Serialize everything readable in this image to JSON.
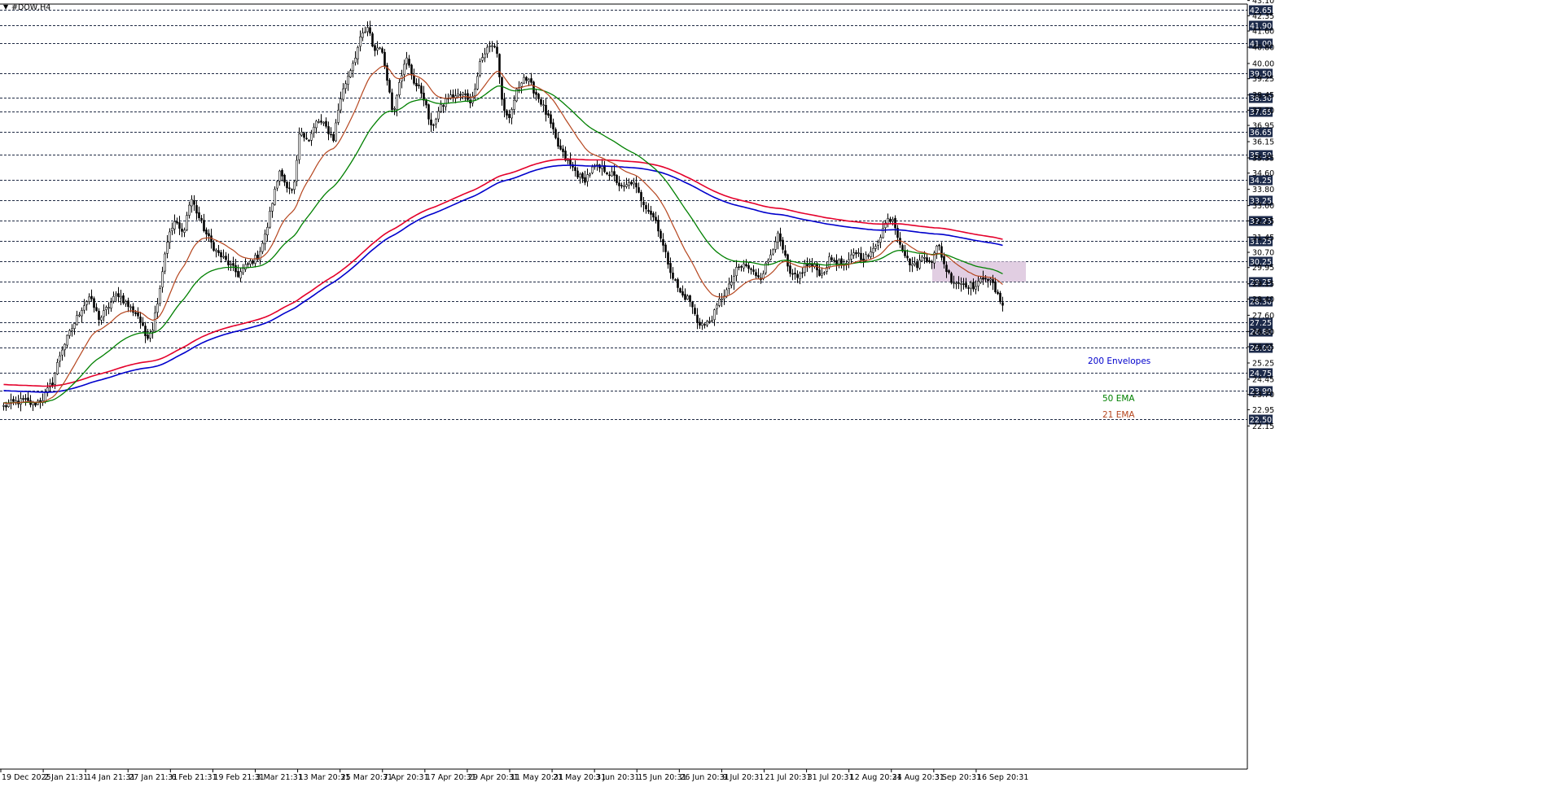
{
  "chart_data": {
    "type": "candlestick",
    "title": "#DOW,H4",
    "symbol": "#DOW",
    "timeframe": "H4",
    "ylim": [
      22.0,
      43.55
    ],
    "y_ticks": [
      43.1,
      42.35,
      41.6,
      40.8,
      40.0,
      39.25,
      38.45,
      37.7,
      36.95,
      36.15,
      35.35,
      34.6,
      33.8,
      33.0,
      32.25,
      31.45,
      30.7,
      29.95,
      29.15,
      28.4,
      27.6,
      26.8,
      26.05,
      25.25,
      24.45,
      23.7,
      22.95,
      22.15
    ],
    "y_tick_labels": [
      "43.10",
      "42.35",
      "41.60",
      "40.80",
      "40.00",
      "39.25",
      "38.45",
      "37.70",
      "36.95",
      "36.15",
      "35.35",
      "34.60",
      "33.80",
      "33.00",
      "32.25",
      "31.45",
      "30.70",
      "29.95",
      "29.15",
      "28.40",
      "27.60",
      "26.80",
      "26.05",
      "25.25",
      "24.45",
      "23.70",
      "22.95",
      "22.15"
    ],
    "levels": [
      43.5,
      42.65,
      41.9,
      41.0,
      39.5,
      38.3,
      37.65,
      36.65,
      35.5,
      34.25,
      33.25,
      32.25,
      31.25,
      30.25,
      29.25,
      28.3,
      27.25,
      26.8,
      26.0,
      24.75,
      23.9,
      22.5
    ],
    "level_labels": [
      "43.50",
      "42.65",
      "41.90",
      "41.00",
      "39.50",
      "38.30",
      "37.65",
      "36.65",
      "35.50",
      "34.25",
      "33.25",
      "32.25",
      "31.25",
      "30.25",
      "29.25",
      "28.30",
      "27.25",
      "26.80",
      "26.00",
      "24.75",
      "23.90",
      "22.50"
    ],
    "x_labels": [
      "19 Dec 2025",
      "2 Jan 21:31",
      "14 Jan 21:31",
      "27 Jan 21:31",
      "6 Feb 21:31",
      "19 Feb 21:31",
      "3 Mar 21:31",
      "13 Mar 20:31",
      "25 Mar 20:31",
      "7 Apr 20:31",
      "17 Apr 20:31",
      "29 Apr 20:31",
      "11 May 20:31",
      "21 May 20:31",
      "3 Jun 20:31",
      "15 Jun 20:31",
      "26 Jun 20:31",
      "9 Jul 20:31",
      "21 Jul 20:31",
      "31 Jul 20:31",
      "12 Aug 20:31",
      "24 Aug 20:31",
      "3 Sep 20:31",
      "16 Sep 20:31"
    ],
    "price_anchors": [
      [
        0,
        23.1
      ],
      [
        12,
        23.3
      ],
      [
        25,
        23.4
      ],
      [
        36,
        23.2
      ],
      [
        48,
        23.5
      ],
      [
        60,
        24.3
      ],
      [
        70,
        25.8
      ],
      [
        82,
        26.8
      ],
      [
        95,
        27.9
      ],
      [
        105,
        28.5
      ],
      [
        118,
        27.4
      ],
      [
        128,
        28.0
      ],
      [
        140,
        28.7
      ],
      [
        152,
        28.1
      ],
      [
        165,
        27.6
      ],
      [
        175,
        26.5
      ],
      [
        183,
        27.0
      ],
      [
        192,
        29.0
      ],
      [
        200,
        31.2
      ],
      [
        210,
        32.2
      ],
      [
        220,
        31.6
      ],
      [
        230,
        33.4
      ],
      [
        240,
        32.4
      ],
      [
        250,
        31.5
      ],
      [
        262,
        30.7
      ],
      [
        275,
        30.2
      ],
      [
        288,
        29.6
      ],
      [
        300,
        30.1
      ],
      [
        312,
        30.5
      ],
      [
        322,
        31.6
      ],
      [
        330,
        33.2
      ],
      [
        340,
        34.9
      ],
      [
        348,
        33.8
      ],
      [
        356,
        33.6
      ],
      [
        364,
        36.8
      ],
      [
        375,
        36.2
      ],
      [
        385,
        37.2
      ],
      [
        395,
        36.9
      ],
      [
        405,
        36.3
      ],
      [
        413,
        38.2
      ],
      [
        422,
        39.3
      ],
      [
        432,
        40.4
      ],
      [
        440,
        41.4
      ],
      [
        448,
        41.7
      ],
      [
        455,
        40.6
      ],
      [
        462,
        40.9
      ],
      [
        470,
        39.6
      ],
      [
        478,
        37.5
      ],
      [
        486,
        39.2
      ],
      [
        495,
        40.2
      ],
      [
        505,
        39.0
      ],
      [
        515,
        38.5
      ],
      [
        525,
        36.8
      ],
      [
        535,
        37.7
      ],
      [
        545,
        38.3
      ],
      [
        555,
        38.4
      ],
      [
        565,
        38.5
      ],
      [
        575,
        38.1
      ],
      [
        585,
        40.1
      ],
      [
        595,
        40.8
      ],
      [
        605,
        40.9
      ],
      [
        612,
        38.2
      ],
      [
        620,
        37.0
      ],
      [
        628,
        38.4
      ],
      [
        638,
        39.4
      ],
      [
        648,
        38.9
      ],
      [
        660,
        38.1
      ],
      [
        670,
        37.2
      ],
      [
        680,
        36.0
      ],
      [
        690,
        35.3
      ],
      [
        700,
        34.8
      ],
      [
        712,
        34.2
      ],
      [
        725,
        34.9
      ],
      [
        737,
        34.8
      ],
      [
        748,
        34.5
      ],
      [
        760,
        33.8
      ],
      [
        772,
        34.2
      ],
      [
        782,
        33.4
      ],
      [
        792,
        32.8
      ],
      [
        802,
        32.2
      ],
      [
        812,
        30.7
      ],
      [
        822,
        29.5
      ],
      [
        832,
        28.6
      ],
      [
        842,
        28.4
      ],
      [
        852,
        27.3
      ],
      [
        862,
        27.1
      ],
      [
        872,
        27.6
      ],
      [
        880,
        28.4
      ],
      [
        890,
        28.9
      ],
      [
        900,
        29.8
      ],
      [
        910,
        30.1
      ],
      [
        920,
        29.7
      ],
      [
        930,
        29.5
      ],
      [
        940,
        30.4
      ],
      [
        950,
        31.6
      ],
      [
        958,
        30.7
      ],
      [
        965,
        29.6
      ],
      [
        975,
        29.4
      ],
      [
        985,
        30.1
      ],
      [
        995,
        30.0
      ],
      [
        1005,
        29.6
      ],
      [
        1015,
        30.4
      ],
      [
        1025,
        30.2
      ],
      [
        1035,
        30.0
      ],
      [
        1045,
        30.8
      ],
      [
        1055,
        30.4
      ],
      [
        1065,
        30.6
      ],
      [
        1075,
        31.4
      ],
      [
        1085,
        32.3
      ],
      [
        1092,
        32.4
      ],
      [
        1100,
        31.3
      ],
      [
        1110,
        30.3
      ],
      [
        1120,
        30.0
      ],
      [
        1130,
        30.5
      ],
      [
        1140,
        30.3
      ],
      [
        1148,
        31.1
      ],
      [
        1156,
        30.0
      ],
      [
        1165,
        29.3
      ],
      [
        1175,
        29.2
      ],
      [
        1185,
        29.1
      ],
      [
        1195,
        29.0
      ],
      [
        1205,
        29.6
      ],
      [
        1215,
        29.1
      ],
      [
        1222,
        28.4
      ],
      [
        1228,
        28.2
      ]
    ],
    "indicators": [
      {
        "name": "200 Envelopes",
        "color": "#0000cc"
      },
      {
        "name": "50 EMA",
        "color": "#008000"
      },
      {
        "name": "21 EMA",
        "color": "#b5461f"
      }
    ],
    "envelope_upper_color": "#e4002b",
    "highlight_box": {
      "y_range": [
        29.25,
        30.25
      ],
      "fill": "#dcc6dd"
    },
    "grid": true,
    "last_price": 28.3
  }
}
